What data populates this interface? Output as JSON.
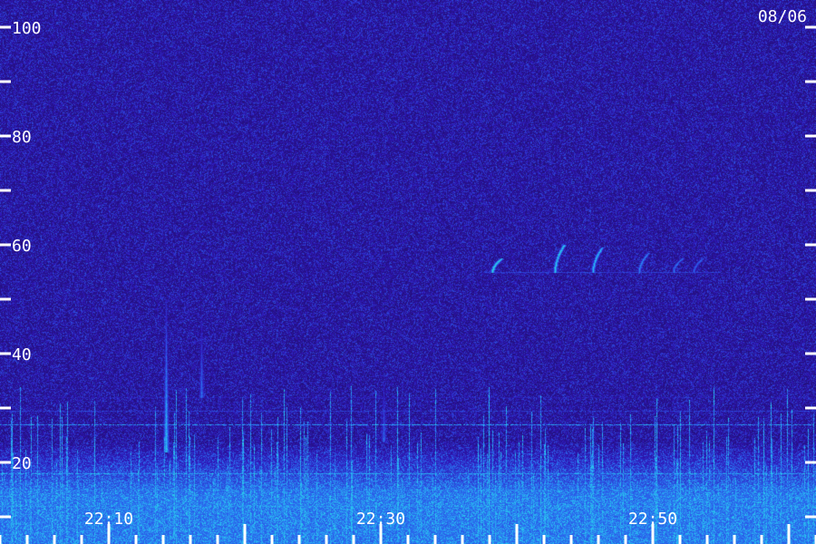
{
  "chart_data": {
    "type": "heatmap",
    "title": "",
    "date_label": "08/06",
    "y_ticks": [
      100,
      80,
      60,
      40,
      20
    ],
    "ylim": [
      10,
      100
    ],
    "x_ticks": [
      "22:10",
      "22:30",
      "22:50"
    ],
    "x_tick_minutes": [
      10,
      30,
      50
    ],
    "xlim_minutes": [
      2,
      62
    ],
    "colormap": [
      "#1d0c5a",
      "#2f17b8",
      "#2a6cf0",
      "#29c6f2",
      "#2df09a"
    ],
    "features": [
      {
        "kind": "band",
        "y": 27,
        "intensity": 0.75
      },
      {
        "kind": "band",
        "y": 29.5,
        "intensity": 0.45
      },
      {
        "kind": "band",
        "y": 32,
        "intensity": 0.3
      },
      {
        "kind": "band",
        "y": 18,
        "intensity": 0.8
      },
      {
        "kind": "band",
        "y": 15,
        "intensity": 0.65
      },
      {
        "kind": "band",
        "y": 12,
        "intensity": 0.7
      },
      {
        "kind": "burst",
        "x": 14.2,
        "y_low": 22,
        "y_high": 50,
        "intensity": 0.9
      },
      {
        "kind": "burst",
        "x": 16.8,
        "y_low": 32,
        "y_high": 48,
        "intensity": 0.6
      },
      {
        "kind": "burst",
        "x": 30.2,
        "y_low": 24,
        "y_high": 36,
        "intensity": 0.6
      },
      {
        "kind": "burst",
        "x": 29.0,
        "y_low": 20,
        "y_high": 30,
        "intensity": 0.4
      },
      {
        "kind": "hook",
        "x": 38.2,
        "y_low": 55,
        "y_high": 57.5,
        "intensity": 0.85
      },
      {
        "kind": "hook",
        "x": 42.8,
        "y_low": 55,
        "y_high": 60,
        "intensity": 0.85
      },
      {
        "kind": "hook",
        "x": 45.6,
        "y_low": 55,
        "y_high": 59.5,
        "intensity": 0.75
      },
      {
        "kind": "hook",
        "x": 49.0,
        "y_low": 55,
        "y_high": 58.5,
        "intensity": 0.6
      },
      {
        "kind": "hook",
        "x": 51.5,
        "y_low": 55,
        "y_high": 57.5,
        "intensity": 0.55
      },
      {
        "kind": "hook",
        "x": 53.0,
        "y_low": 55,
        "y_high": 57.5,
        "intensity": 0.5
      },
      {
        "kind": "band_segment",
        "y": 55,
        "x_start": 37.5,
        "x_end": 55,
        "intensity": 0.45
      }
    ]
  }
}
